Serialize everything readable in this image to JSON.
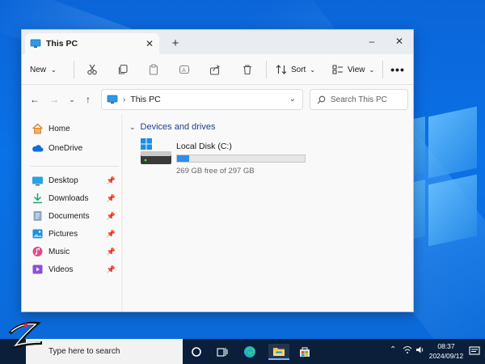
{
  "window": {
    "tab_title": "This PC",
    "new_tab": "+",
    "minimize": "–",
    "close": "✕"
  },
  "toolbar": {
    "new_label": "New",
    "sort_label": "Sort",
    "view_label": "View",
    "more": "•••",
    "icons": [
      "cut-icon",
      "copy-icon",
      "paste-icon",
      "rename-icon",
      "share-icon",
      "delete-icon"
    ]
  },
  "address": {
    "path": "This PC",
    "search_placeholder": "Search This PC"
  },
  "sidebar": {
    "items": [
      {
        "label": "Home",
        "icon": "home-icon",
        "pinned": false
      },
      {
        "label": "OneDrive",
        "icon": "cloud-icon",
        "pinned": false
      },
      {
        "label": "Desktop",
        "icon": "desktop-icon",
        "pinned": true
      },
      {
        "label": "Downloads",
        "icon": "download-icon",
        "pinned": true
      },
      {
        "label": "Documents",
        "icon": "document-icon",
        "pinned": true
      },
      {
        "label": "Pictures",
        "icon": "pictures-icon",
        "pinned": true
      },
      {
        "label": "Music",
        "icon": "music-icon",
        "pinned": true
      },
      {
        "label": "Videos",
        "icon": "videos-icon",
        "pinned": true
      }
    ]
  },
  "content": {
    "group_title": "Devices and drives",
    "drive": {
      "name": "Local Disk (C:)",
      "free_text": "269 GB free of 297 GB",
      "used_fraction": 0.094
    }
  },
  "taskbar": {
    "search_placeholder": "Type here to search",
    "time": "08:37",
    "date": "2024/09/12"
  },
  "colors": {
    "accent": "#2d8fe8",
    "group_header": "#1a3f8f",
    "taskbar": "#0b1f3a"
  }
}
